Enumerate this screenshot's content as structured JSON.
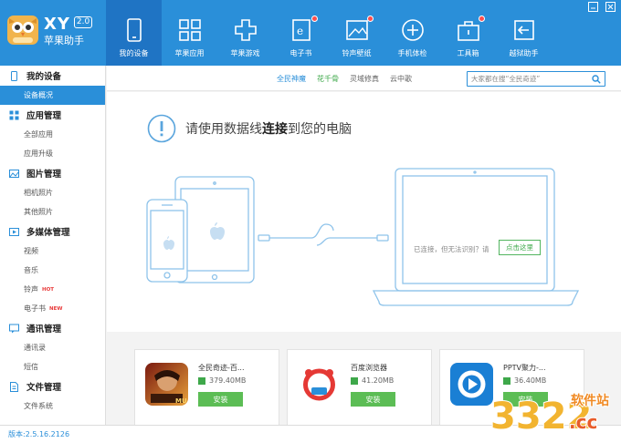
{
  "app": {
    "brand": "XY",
    "version_badge": "2.0",
    "name": "苹果助手"
  },
  "nav": [
    {
      "label": "我的设备",
      "icon": "phone-icon",
      "active": true
    },
    {
      "label": "苹果应用",
      "icon": "apps-grid-icon"
    },
    {
      "label": "苹果游戏",
      "icon": "gamepad-icon"
    },
    {
      "label": "电子书",
      "icon": "ebook-icon",
      "dot": true
    },
    {
      "label": "铃声壁纸",
      "icon": "wallpaper-icon",
      "dot": true
    },
    {
      "label": "手机体检",
      "icon": "plus-circle-icon"
    },
    {
      "label": "工具箱",
      "icon": "toolbox-icon",
      "dot": true
    },
    {
      "label": "越狱助手",
      "icon": "jailbreak-icon"
    }
  ],
  "sidebar": {
    "groups": [
      {
        "title": "我的设备",
        "icon": "device-icon",
        "items": [
          {
            "label": "设备概况",
            "active": true
          }
        ]
      },
      {
        "title": "应用管理",
        "icon": "app-grid-icon",
        "items": [
          {
            "label": "全部应用"
          },
          {
            "label": "应用升级"
          }
        ]
      },
      {
        "title": "图片管理",
        "icon": "picture-icon",
        "items": [
          {
            "label": "相机照片"
          },
          {
            "label": "其他照片"
          }
        ]
      },
      {
        "title": "多媒体管理",
        "icon": "media-icon",
        "items": [
          {
            "label": "视频"
          },
          {
            "label": "音乐"
          },
          {
            "label": "铃声",
            "tag": "HOT"
          },
          {
            "label": "电子书",
            "tag": "NEW"
          }
        ]
      },
      {
        "title": "通讯管理",
        "icon": "chat-icon",
        "items": [
          {
            "label": "通讯录"
          },
          {
            "label": "短信"
          }
        ]
      },
      {
        "title": "文件管理",
        "icon": "file-icon",
        "items": [
          {
            "label": "文件系统"
          }
        ]
      }
    ]
  },
  "topbar": {
    "links": [
      "全民神魔",
      "花千骨",
      "灵域修真",
      "云中歌"
    ],
    "search_placeholder": "大家都在搜“全民奇迹”"
  },
  "connect": {
    "title_pre": "请使用数据线",
    "title_bold": "连接",
    "title_post": "到您的电脑",
    "status": "已连接，但无法识别？请",
    "fix_label": "点击这里"
  },
  "apps": [
    {
      "name": "全民奇迹-百...",
      "size": "379.40MB",
      "install": "安装"
    },
    {
      "name": "百度浏览器",
      "size": "41.20MB",
      "install": "安装"
    },
    {
      "name": "PPTV聚力-...",
      "size": "36.40MB",
      "install": "安装"
    }
  ],
  "footer": {
    "version": "版本:2.5.16.2126"
  },
  "watermark": {
    "number": "3322",
    "site": "软件站",
    "domain": ".cc"
  },
  "colors": {
    "primary": "#2a8fd9",
    "active_nav": "#1f74c4",
    "green": "#5cbd55",
    "badge": "#ff4d4d"
  }
}
